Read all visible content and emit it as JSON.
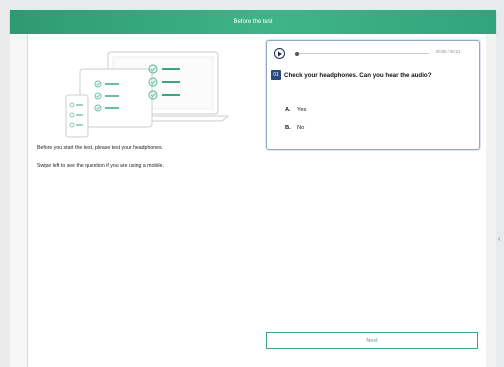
{
  "header": {
    "title": "Before the test"
  },
  "left": {
    "instruction_1": "Before you start the test, please test your headphones.",
    "instruction_2": "Swipe left to see the question if you are using a mobile."
  },
  "audio": {
    "time": "00:00 / 00:21"
  },
  "question": {
    "number": "01",
    "text": "Check your headphones. Can you hear the audio?",
    "options": [
      {
        "letter": "A.",
        "label": "Yes"
      },
      {
        "letter": "B.",
        "label": "No"
      }
    ]
  },
  "footer": {
    "next_label": "Next"
  },
  "colors": {
    "accent": "#3aa57e",
    "qnum_bg": "#2a4a7a"
  }
}
